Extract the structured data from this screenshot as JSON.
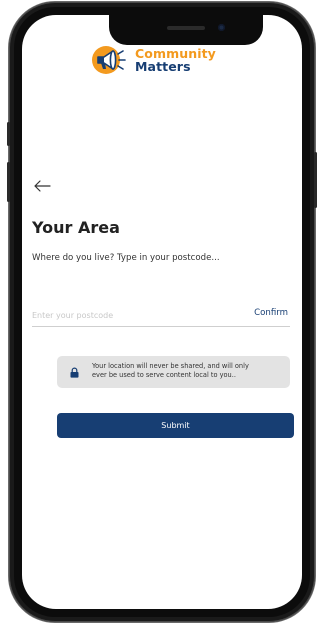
{
  "app": {
    "logo_line1": "Community",
    "logo_line2": "Matters"
  },
  "screen": {
    "title": "Your Area",
    "subtitle": "Where do you live? Type in your postcode..."
  },
  "postcode": {
    "value": "",
    "placeholder": "Enter your postcode",
    "confirm_label": "Confirm"
  },
  "notice": {
    "line1": "Your location will never be shared, and will only",
    "line2": "ever be used to serve content local to you.."
  },
  "submit": {
    "label": "Submit"
  },
  "icons": {
    "back": "arrow-left-icon",
    "lock": "lock-icon",
    "logo": "megaphone-icon"
  },
  "colors": {
    "primary": "#173e73",
    "accent": "#f39a1f",
    "notice_bg": "#e3e3e3"
  }
}
